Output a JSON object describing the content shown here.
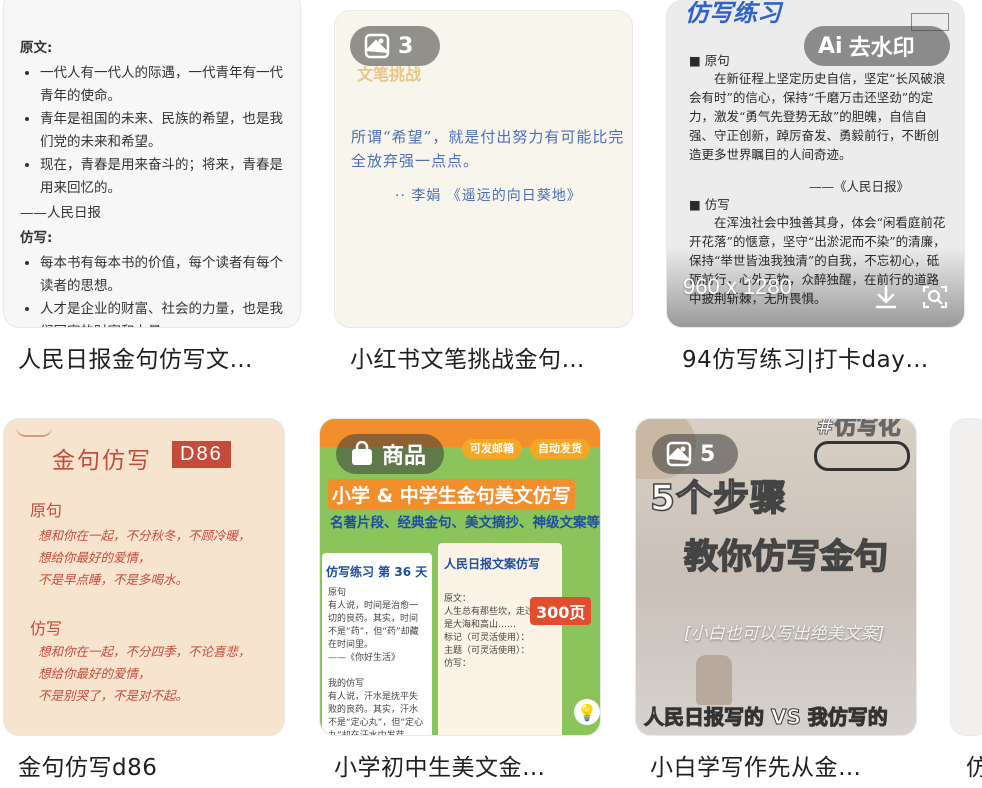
{
  "cards": [
    {
      "caption": "人民日报金句仿写文…",
      "content": {
        "heading1": "原文:",
        "orig": [
          "一代人有一代人的际遇，一代青年有一代青年的使命。",
          "青年是祖国的未来、民族的希望，也是我们党的未来和希望。",
          "现在，青春是用来奋斗的；将来，青春是用来回忆的。"
        ],
        "source": "——人民日报",
        "heading2": "仿写:",
        "imit": [
          "每本书有每本书的价值，每个读者有每个读者的思想。",
          "人才是企业的财富、社会的力量，也是我们国家的财富和力量。"
        ]
      }
    },
    {
      "caption": "小红书文笔挑战金句…",
      "badge_count": "3",
      "content": {
        "faded_title": "文笔挑战",
        "quote": "所谓“希望”，就是付出努力有可能比完全放弃强一点点。",
        "author": "·· 李娟 《遥远的向日葵地》"
      }
    },
    {
      "caption": "94仿写练习|打卡day…",
      "watermark_label": "去水印",
      "dims": "960 x 1280",
      "content": {
        "title": "仿写练习",
        "s1": "■ 原句",
        "p1": "在新征程上坚定历史自信，坚定“长风破浪会有时”的信心，保持“千磨万击还坚劲”的定力，激发“勇气先登势无敌”的胆魄，自信自强、守正创新，踔厉奋发、勇毅前行，不断创造更多世界瞩目的人间奇迹。",
        "src": "——《人民日报》",
        "s2": "■ 仿写",
        "p2": "在浑浊社会中独善其身，体会“闲看庭前花开花落”的惬意，坚守“出淤泥而不染”的清廉，保持“举世皆浊我独清”的自我，不忘初心，砥砺前行，心外无物，众醉独醒，在前行的道路中披荆斩棘，无所畏惧。"
      }
    },
    {
      "caption": "金句仿写d86",
      "content": {
        "title": "金句仿写",
        "tag": "D86",
        "sub1": "原句",
        "orig": [
          "想和你在一起，不分秋冬，不顾冷暖，",
          "想给你最好的爱情，",
          "不是早点睡，不是多喝水。"
        ],
        "sub2": "仿写",
        "imit": [
          "想和你在一起，不分四季，不论喜悲，",
          "想给你最好的爱情，",
          "不是别哭了，不是对不起。"
        ]
      }
    },
    {
      "caption": "小学初中生美文金…",
      "badge_label": "商品",
      "content": {
        "chip1": "可发邮箱",
        "chip2": "自动发货",
        "headline": "小学 & 中学生金句美文仿写",
        "subline": "名著片段、经典金句、美文摘抄、神级文案等",
        "left_title": "仿写练习 第 36 天",
        "right_title": "人民日报文案仿写",
        "price": "300页",
        "left_text": "原句\n有人说，时间是治愈一切的良药。其实，时间不是“药”，但“药”却藏在时间里。\n——《你好生活》\n\n我的仿写\n有人说，汗水是抚平失败的良药。其实，汗水不是“定心丸”，但“定心丸”却在汗水中发芽。",
        "right_text": "原文：\n人生总有那些坎，走过去就是大海和高山……\n标记（可灵活使用）：\n主题（可灵活使用）：\n仿写："
      }
    },
    {
      "caption": "小白学写作先从金…",
      "badge_count": "5",
      "content": {
        "top": "#仿写化",
        "steps": "5个步骤",
        "teach": "教你仿写金句",
        "strip": "[小白也可以写出绝美文案]",
        "bottom": "人民日报写的 VS 我仿写的"
      }
    },
    {
      "caption": "仿"
    }
  ]
}
